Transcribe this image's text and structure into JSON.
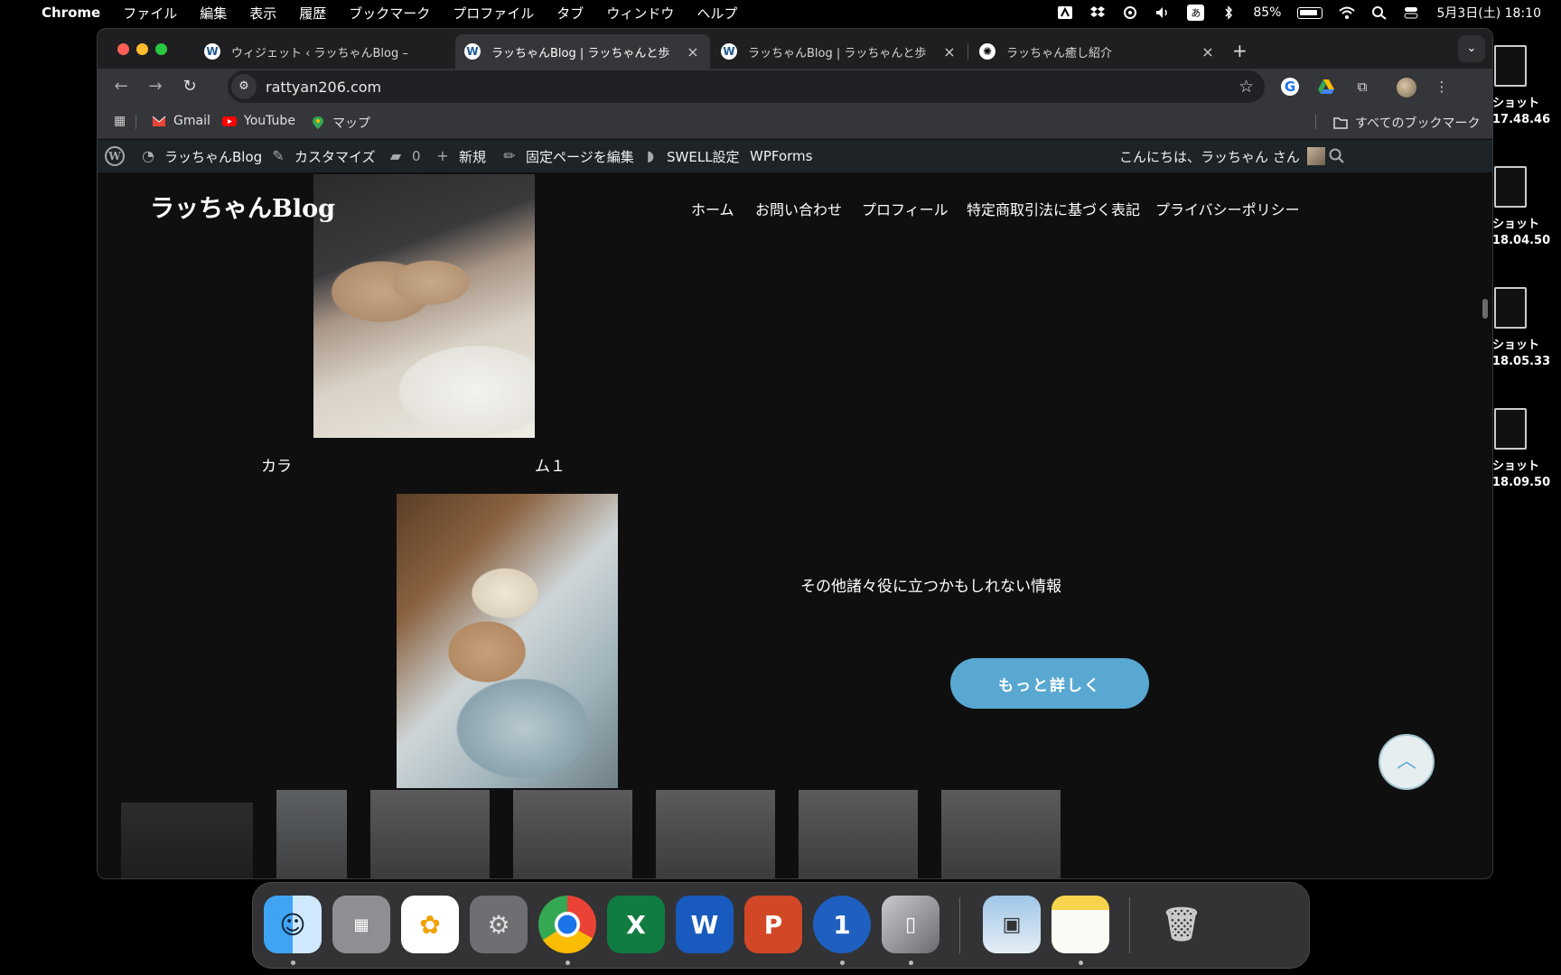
{
  "menubar": {
    "app_name": "Chrome",
    "menus": [
      "ファイル",
      "編集",
      "表示",
      "履歴",
      "ブックマーク",
      "プロファイル",
      "タブ",
      "ウィンドウ",
      "ヘルプ"
    ],
    "ime": "あ",
    "battery": "85%",
    "datetime": "5月3日(土)  18:10"
  },
  "desktop_thumbs": [
    {
      "label1": "ショット",
      "label2": "17.48.46"
    },
    {
      "label1": "ショット",
      "label2": "18.04.50"
    },
    {
      "label1": "ショット",
      "label2": "18.05.33"
    },
    {
      "label1": "ショット",
      "label2": "18.09.50"
    }
  ],
  "tabs": [
    {
      "title": "ウィジェット ‹ ラッちゃんBlog –"
    },
    {
      "title": "ラッちゃんBlog | ラッちゃんと歩"
    },
    {
      "title": "ラッちゃんBlog | ラッちゃんと歩"
    },
    {
      "title": "ラッちゃん癒し紹介"
    }
  ],
  "address": "rattyan206.com",
  "bookmarks": {
    "items": [
      "Gmail",
      "YouTube",
      "マップ"
    ],
    "all": "すべてのブックマーク"
  },
  "wpbar": {
    "site": "ラッちゃんBlog",
    "customize": "カスタマイズ",
    "comments": "0",
    "new": "新規",
    "edit": "固定ページを編集",
    "swell": "SWELL設定",
    "wpforms": "WPForms",
    "greeting": "こんにちは、ラッちゃん さん"
  },
  "site": {
    "title": "ラッちゃんBlog",
    "nav": [
      "ホーム",
      "お問い合わせ",
      "プロフィール",
      "特定商取引法に基づく表記",
      "プライバシーポリシー"
    ],
    "caption_left": "カラ",
    "caption_right": "ム１",
    "info": "その他諸々役に立つかもしれない情報",
    "more_button": "もっと詳しく"
  }
}
